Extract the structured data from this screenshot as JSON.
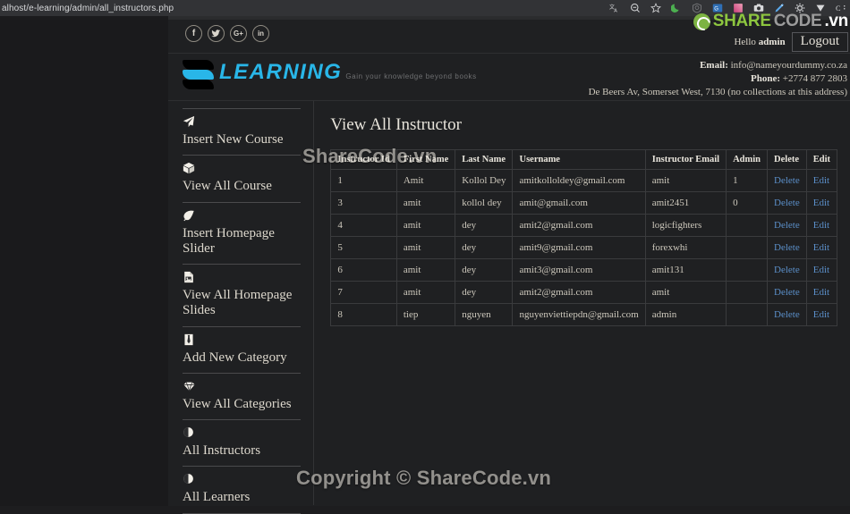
{
  "browser": {
    "url": "alhost/e-learning/admin/all_instructors.php",
    "toolbar_icons": [
      "translate-icon",
      "zoom-out-icon",
      "bookmark-star-icon",
      "dark-mode-moon-icon",
      "shield-check-icon",
      "extension-blue-icon",
      "color-picker-square-icon",
      "camera-icon",
      "eyedropper-pencil-icon",
      "gear-icon",
      "chevron-v-icon",
      "caret-c-icon"
    ]
  },
  "topbar": {
    "social": [
      {
        "name": "facebook-icon",
        "glyph": "f"
      },
      {
        "name": "twitter-icon",
        "glyph": "❈"
      },
      {
        "name": "google-plus-icon",
        "glyph": "G+"
      },
      {
        "name": "linkedin-icon",
        "glyph": "in"
      }
    ],
    "logo": {
      "share": "SHARE",
      "code": "CODE",
      "vn": ".vn"
    },
    "hello_prefix": "Hello ",
    "hello_user": "admin",
    "logout_label": "Logout"
  },
  "header": {
    "brand_name": "LEARNING",
    "brand_tagline": "Gain your knowledge beyond books",
    "email_label": "Email:",
    "email_value": " info@nameyourdummy.co.za",
    "phone_label": "Phone:",
    "phone_value": " +2774 877 2803",
    "address": "De Beers Av, Somerset West, 7130 (no collections at this address)"
  },
  "sidebar": {
    "items": [
      {
        "icon": "paper-plane-icon",
        "glyph": "➤",
        "label": "Insert New Course"
      },
      {
        "icon": "cube-box-icon",
        "glyph": "⬛",
        "label": "View All Course"
      },
      {
        "icon": "leaf-icon",
        "glyph": "❧",
        "label": "Insert Homepage Slider"
      },
      {
        "icon": "image-file-icon",
        "glyph": "Ὓc",
        "label": "View All Homepage Slides"
      },
      {
        "icon": "necktie-icon",
        "glyph": "⬜",
        "label": "Add New Category"
      },
      {
        "icon": "diamond-gem-icon",
        "glyph": "⬟",
        "label": "View All Categories"
      },
      {
        "icon": "adjust-contrast-icon",
        "glyph": "◐",
        "label": "All Instructors"
      },
      {
        "icon": "adjust-contrast-icon",
        "glyph": "◐",
        "label": "All Learners"
      }
    ]
  },
  "main": {
    "title": "View All Instructor",
    "table": {
      "columns": [
        "Instructor Id",
        "First Name",
        "Last Name",
        "Username",
        "Instructor Email",
        "Admin",
        "Delete",
        "Edit"
      ],
      "rows": [
        {
          "id": "1",
          "first": "Amit",
          "last": "Kollol Dey",
          "username": "amitkolloldey@gmail.com",
          "email": "amit",
          "admin": "1",
          "delete": "Delete",
          "edit": "Edit"
        },
        {
          "id": "3",
          "first": "amit",
          "last": "kollol dey",
          "username": "amit@gmail.com",
          "email": "amit2451",
          "admin": "0",
          "delete": "Delete",
          "edit": "Edit"
        },
        {
          "id": "4",
          "first": "amit",
          "last": "dey",
          "username": "amit2@gmail.com",
          "email": "logicfighters",
          "admin": "",
          "delete": "Delete",
          "edit": "Edit"
        },
        {
          "id": "5",
          "first": "amit",
          "last": "dey",
          "username": "amit9@gmail.com",
          "email": "forexwhi",
          "admin": "",
          "delete": "Delete",
          "edit": "Edit"
        },
        {
          "id": "6",
          "first": "amit",
          "last": "dey",
          "username": "amit3@gmail.com",
          "email": "amit131",
          "admin": "",
          "delete": "Delete",
          "edit": "Edit"
        },
        {
          "id": "7",
          "first": "amit",
          "last": "dey",
          "username": "amit2@gmail.com",
          "email": "amit",
          "admin": "",
          "delete": "Delete",
          "edit": "Edit"
        },
        {
          "id": "8",
          "first": "tiep",
          "last": "nguyen",
          "username": "nguyenviettiepdn@gmail.com",
          "email": "admin",
          "admin": "",
          "delete": "Delete",
          "edit": "Edit"
        }
      ]
    }
  },
  "watermarks": {
    "top": "ShareCode.vn",
    "bottom": "Copyright © ShareCode.vn"
  },
  "colors": {
    "accent_cyan": "#29b6e8",
    "link_blue": "#5b8fc9",
    "logo_green": "#8dc63f",
    "page_bg": "#1f2022"
  }
}
